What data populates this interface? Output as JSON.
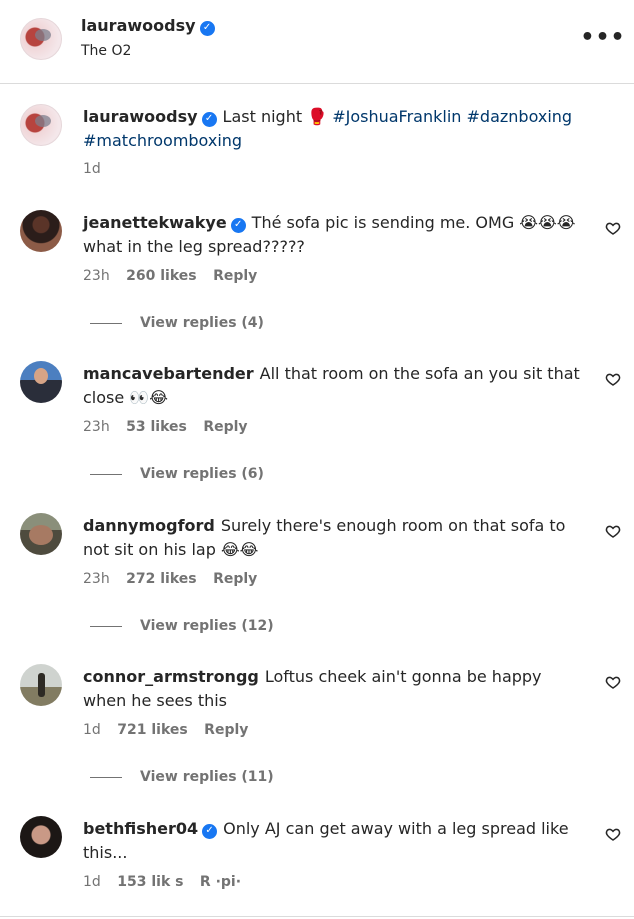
{
  "header": {
    "username": "laurawoodsy",
    "location": "The O2",
    "more_icon": "more-horizontal-icon",
    "more_label": "•••"
  },
  "caption": {
    "username": "laurawoodsy",
    "text": "Last night",
    "emoji": "🥊",
    "tags": [
      "#JoshuaFranklin",
      "#daznboxing",
      "#matchroomboxing"
    ],
    "time": "1d"
  },
  "comments": [
    {
      "username": "jeanettekwakye",
      "verified": true,
      "text": "Thé sofa pic is sending me. OMG 😭😭😭 what in the leg spread?????",
      "time": "23h",
      "likes": "260 likes",
      "reply": "Reply",
      "view_replies": "View replies (4)"
    },
    {
      "username": "mancavebartender",
      "verified": false,
      "text": "All that room on the sofa an you sit that close 👀😂",
      "time": "23h",
      "likes": "53 likes",
      "reply": "Reply",
      "view_replies": "View replies (6)"
    },
    {
      "username": "dannymogford",
      "verified": false,
      "text": "Surely there's enough room on that sofa to not sit on his lap 😂😂",
      "time": "23h",
      "likes": "272 likes",
      "reply": "Reply",
      "view_replies": "View replies (12)"
    },
    {
      "username": "connor_armstrongg",
      "verified": false,
      "text": "Loftus cheek ain't gonna be happy when he sees this",
      "time": "1d",
      "likes": "721 likes",
      "reply": "Reply",
      "view_replies": "View replies (11)"
    },
    {
      "username": "bethfisher04",
      "verified": true,
      "text": "Only AJ can get away with a leg spread like this...",
      "time": "1d",
      "likes": "153 lik s",
      "reply": "R ·pi·",
      "view_replies": ""
    }
  ],
  "icons": {
    "verified": "verified-badge-icon",
    "heart": "heart-outline-icon"
  },
  "colors": {
    "verified": "#1877f2",
    "hashtag": "#00376b",
    "meta": "#737373",
    "divider": "#dbdbdb"
  }
}
